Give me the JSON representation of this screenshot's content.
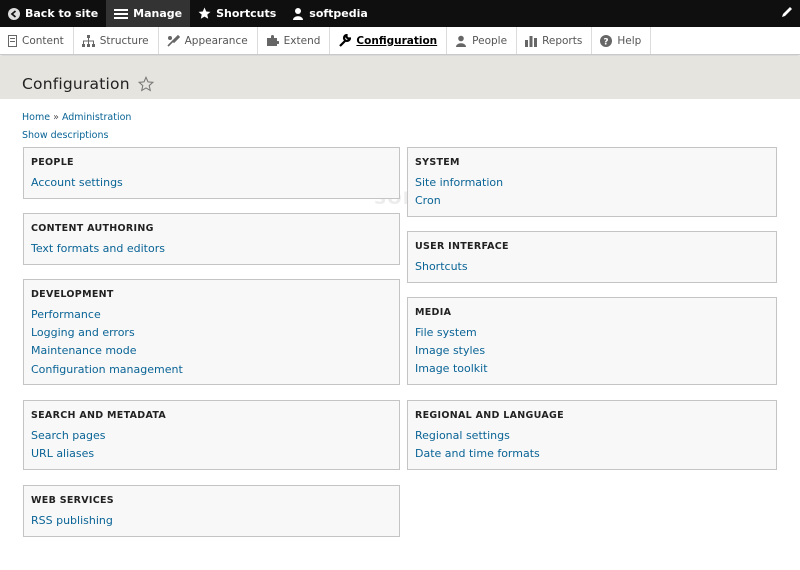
{
  "toolbar": {
    "back_label": "Back to site",
    "manage_label": "Manage",
    "shortcuts_label": "Shortcuts",
    "user_label": "softpedia"
  },
  "tray": {
    "items": [
      {
        "label": "Content",
        "icon": "content-icon"
      },
      {
        "label": "Structure",
        "icon": "structure-icon"
      },
      {
        "label": "Appearance",
        "icon": "appearance-icon"
      },
      {
        "label": "Extend",
        "icon": "extend-icon"
      },
      {
        "label": "Configuration",
        "icon": "wrench-icon"
      },
      {
        "label": "People",
        "icon": "people-icon"
      },
      {
        "label": "Reports",
        "icon": "reports-icon"
      },
      {
        "label": "Help",
        "icon": "help-icon"
      }
    ],
    "active": "Configuration"
  },
  "page": {
    "title": "Configuration",
    "breadcrumb": {
      "home": "Home",
      "separator": "»",
      "admin": "Administration"
    },
    "show_descriptions": "Show descriptions",
    "watermark": "SOFTPEDIA"
  },
  "panels": {
    "people": {
      "title": "PEOPLE",
      "links": [
        "Account settings"
      ]
    },
    "content_authoring": {
      "title": "CONTENT AUTHORING",
      "links": [
        "Text formats and editors"
      ]
    },
    "development": {
      "title": "DEVELOPMENT",
      "links": [
        "Performance",
        "Logging and errors",
        "Maintenance mode",
        "Configuration management"
      ]
    },
    "search_metadata": {
      "title": "SEARCH AND METADATA",
      "links": [
        "Search pages",
        "URL aliases"
      ]
    },
    "web_services": {
      "title": "WEB SERVICES",
      "links": [
        "RSS publishing"
      ]
    },
    "system": {
      "title": "SYSTEM",
      "links": [
        "Site information",
        "Cron"
      ]
    },
    "user_interface": {
      "title": "USER INTERFACE",
      "links": [
        "Shortcuts"
      ]
    },
    "media": {
      "title": "MEDIA",
      "links": [
        "File system",
        "Image styles",
        "Image toolkit"
      ]
    },
    "regional": {
      "title": "REGIONAL AND LANGUAGE",
      "links": [
        "Regional settings",
        "Date and time formats"
      ]
    }
  },
  "colors": {
    "link": "#0a6496",
    "toolbar_bg": "#0f0f0f",
    "header_band": "#e5e4df",
    "panel_bg": "#f8f8f8"
  }
}
